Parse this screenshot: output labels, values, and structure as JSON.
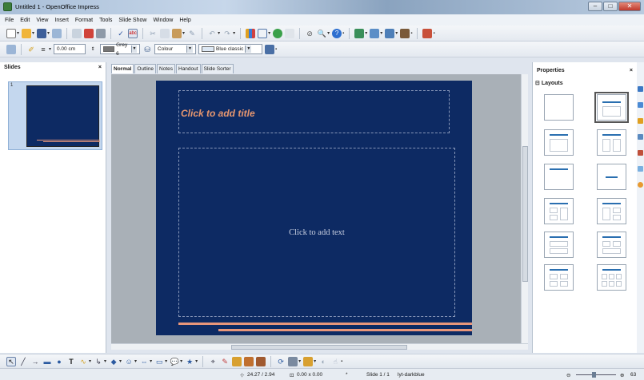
{
  "window": {
    "title": "Untitled 1 - OpenOffice Impress",
    "buttons": {
      "minimize": "–",
      "maximize": "□",
      "close": "✕"
    }
  },
  "menu": [
    "File",
    "Edit",
    "View",
    "Insert",
    "Format",
    "Tools",
    "Slide Show",
    "Window",
    "Help"
  ],
  "line_toolbar": {
    "width_value": "0.00 cm",
    "line_color_name": "Grey 6",
    "fill_type": "Colour",
    "fill_color_name": "Blue classic"
  },
  "slides_pane": {
    "title": "Slides",
    "close": "×",
    "thumbnail_number": "1"
  },
  "view_tabs": [
    "Normal",
    "Outline",
    "Notes",
    "Handout",
    "Slide Sorter"
  ],
  "slide": {
    "title_placeholder": "Click to add title",
    "text_placeholder": "Click to add text"
  },
  "properties": {
    "title": "Properties",
    "close": "×",
    "section": "Layouts"
  },
  "status": {
    "position": "24.27 / 2.94",
    "size": "0.00 x 0.00",
    "slide": "Slide 1 / 1",
    "master": "lyt-darkblue",
    "zoom": "63"
  },
  "colors": {
    "slide_bg": "#0d2a63",
    "accent": "#e9967a",
    "title_text": "#e8976f"
  }
}
